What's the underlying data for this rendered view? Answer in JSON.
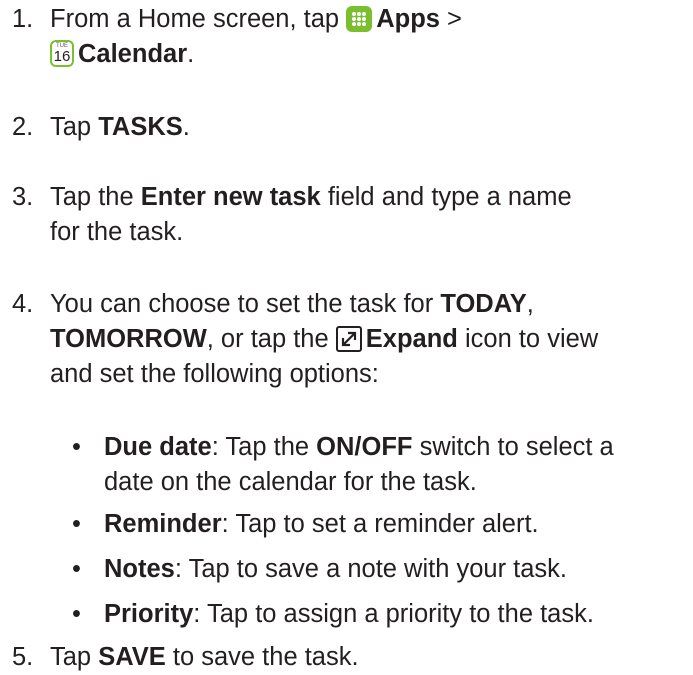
{
  "steps": [
    {
      "num": "1.",
      "pre": "From a Home screen, tap",
      "apps": "Apps",
      "sep": ">",
      "calendar": "Calendar",
      "end": "."
    },
    {
      "num": "2.",
      "pre": "Tap",
      "b1": "TASKS",
      "end": "."
    },
    {
      "num": "3.",
      "pre": "Tap the",
      "b1": "Enter new task",
      "line1_end": "field and type a name",
      "line2": "for the task."
    },
    {
      "num": "4.",
      "pre": "You can choose to set the task for",
      "b1": "TODAY",
      "c1": ",",
      "b2": "TOMORROW",
      "c2": ", or tap the",
      "b3": "Expand",
      "c3": "icon to view",
      "line3": "and set the following options:"
    },
    {
      "num": "5.",
      "pre": "Tap",
      "b1": "SAVE",
      "end": "to save the task."
    }
  ],
  "options": [
    {
      "label": "Due date",
      "pre": ": Tap the",
      "b1": "ON/OFF",
      "line1_end": "switch to select a",
      "line2": "date on the calendar for the task."
    },
    {
      "label": "Reminder",
      "text": ": Tap to set a reminder alert."
    },
    {
      "label": "Notes",
      "text": ": Tap to save a note with your task."
    },
    {
      "label": "Priority",
      "text": ": Tap to assign a priority to the task."
    }
  ],
  "bullet": "•",
  "calendar_icon": {
    "day": "TUE",
    "date": "16"
  },
  "icons": [
    "apps-icon",
    "calendar-icon",
    "expand-icon"
  ],
  "colors": {
    "accent": "#7bbf2e",
    "text": "#231f20"
  }
}
